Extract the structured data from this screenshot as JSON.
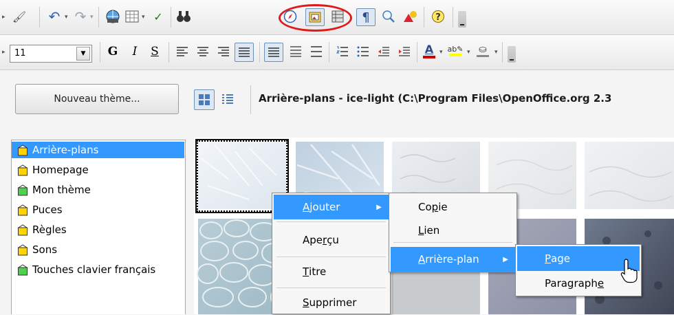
{
  "toolbar_font_size": "11",
  "format_buttons": {
    "bold": "G",
    "italic": "I",
    "underline": "S"
  },
  "gallery": {
    "new_theme_button": "Nouveau thème...",
    "header_title": "Arrière-plans - ice-light (C:\\Program Files\\OpenOffice.org 2.3",
    "themes": [
      {
        "label": "Arrière-plans",
        "selected": true,
        "icon": "theme-icon-yellow"
      },
      {
        "label": "Homepage",
        "selected": false,
        "icon": "theme-icon-yellow"
      },
      {
        "label": "Mon thème",
        "selected": false,
        "icon": "theme-icon-green"
      },
      {
        "label": "Puces",
        "selected": false,
        "icon": "theme-icon-yellow"
      },
      {
        "label": "Règles",
        "selected": false,
        "icon": "theme-icon-yellow"
      },
      {
        "label": "Sons",
        "selected": false,
        "icon": "theme-icon-yellow"
      },
      {
        "label": "Touches clavier français",
        "selected": false,
        "icon": "theme-icon-green"
      }
    ]
  },
  "context_menu": {
    "items": [
      {
        "label": "Ajouter",
        "accel": "A",
        "rest": "jouter",
        "highlighted": true,
        "submenu": true
      },
      {
        "label": "Aperçu",
        "accel": "",
        "pre": "Ape",
        "u": "r",
        "post": "çu"
      },
      {
        "label": "Titre",
        "pre": "",
        "u": "T",
        "post": "itre"
      },
      {
        "label": "Supprimer",
        "pre": "",
        "u": "S",
        "post": "upprimer"
      }
    ]
  },
  "submenu_ajouter": {
    "copie": {
      "pre": "Co",
      "u": "p",
      "post": "ie"
    },
    "lien": {
      "pre": "",
      "u": "L",
      "post": "ien"
    },
    "arriere_plan": {
      "pre": "",
      "u": "A",
      "post": "rrière-plan"
    }
  },
  "submenu_arriere_plan": {
    "page": {
      "pre": "",
      "u": "P",
      "post": "age"
    },
    "paragraphe": {
      "pre": "Paragraph",
      "u": "e",
      "post": ""
    }
  },
  "colors": {
    "highlight": "#3399ff",
    "annotation_red": "#e01a1a",
    "font_color_bar": "#cc0000",
    "highlight_bar": "#ffff00"
  }
}
